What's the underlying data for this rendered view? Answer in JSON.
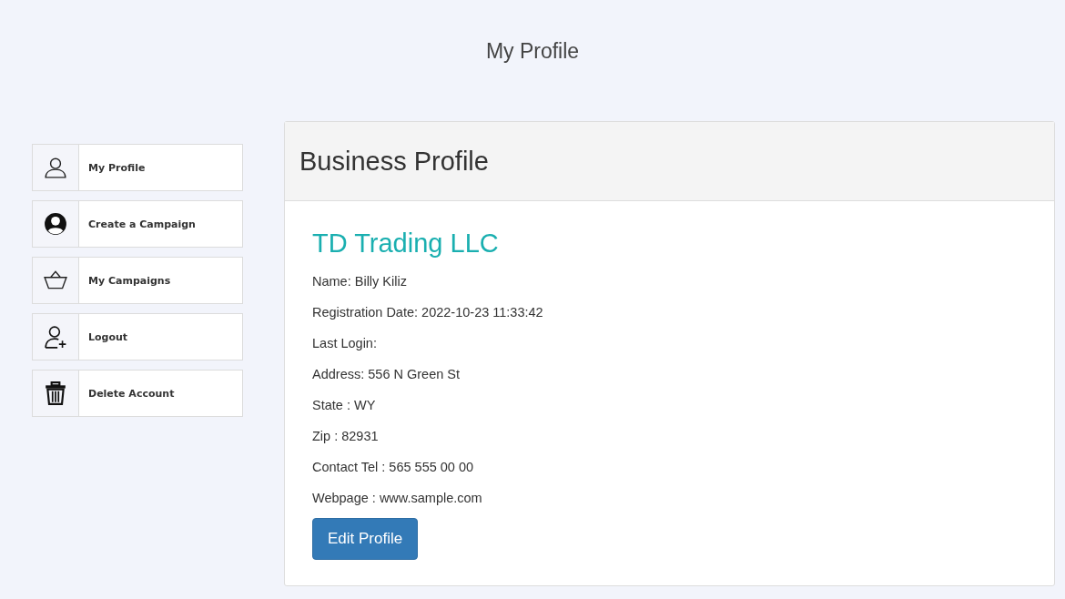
{
  "page_title": "My Profile",
  "sidebar": {
    "items": [
      {
        "label": "My Profile"
      },
      {
        "label": "Create a Campaign"
      },
      {
        "label": "My Campaigns"
      },
      {
        "label": "Logout"
      },
      {
        "label": "Delete Account"
      }
    ]
  },
  "card": {
    "title": "Business Profile",
    "company": "TD Trading LLC",
    "details": [
      "Name: Billy Kiliz",
      "Registration Date: 2022-10-23 11:33:42",
      "Last Login:",
      "Address: 556 N Green St",
      "State : WY",
      "Zip : 82931",
      "Contact Tel : 565 555 00 00",
      "Webpage : www.sample.com"
    ],
    "button": "Edit Profile"
  }
}
